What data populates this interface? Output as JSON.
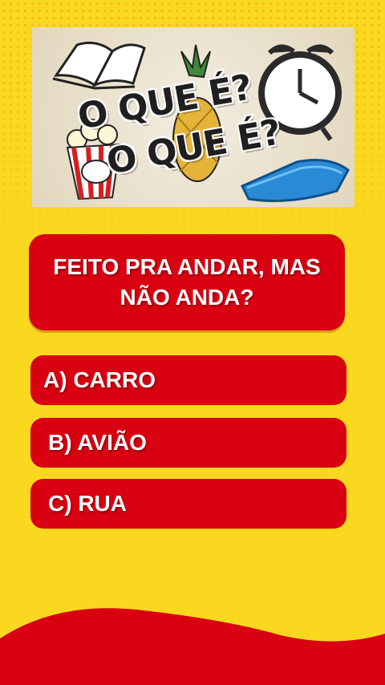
{
  "banner": {
    "title_line1": "O QUE É?",
    "title_line2": "O QUE É?"
  },
  "question": {
    "text": "FEITO PRA ANDAR, MAS NÃO ANDA?"
  },
  "options": [
    {
      "label": "A) CARRO"
    },
    {
      "label": "B) AVIÃO"
    },
    {
      "label": "C) RUA"
    }
  ],
  "colors": {
    "background": "#f9d81f",
    "accent": "#d90011",
    "text": "#ffffff"
  }
}
